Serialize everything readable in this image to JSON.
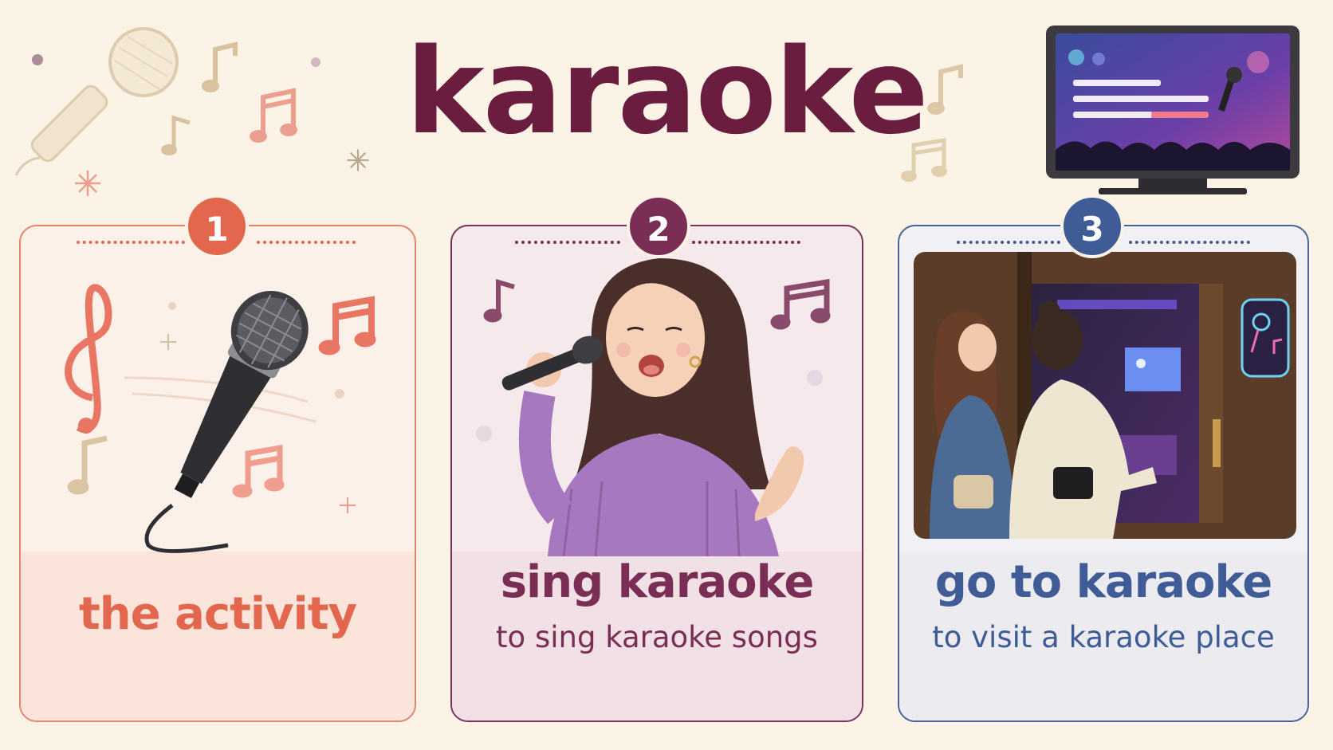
{
  "title": "karaoke",
  "cards": [
    {
      "number": "1",
      "label": "the activity",
      "subtitle": "",
      "color": "#e3664e"
    },
    {
      "number": "2",
      "label": "sing karaoke",
      "subtitle": "to sing karaoke songs",
      "color": "#7a2e55"
    },
    {
      "number": "3",
      "label": "go to karaoke",
      "subtitle": "to visit a karaoke place",
      "color": "#3f5c97"
    }
  ],
  "icons": [
    "microphone-icon",
    "music-note-icon",
    "tv-screen-icon",
    "treble-clef-icon",
    "neon-mic-sign-icon"
  ]
}
